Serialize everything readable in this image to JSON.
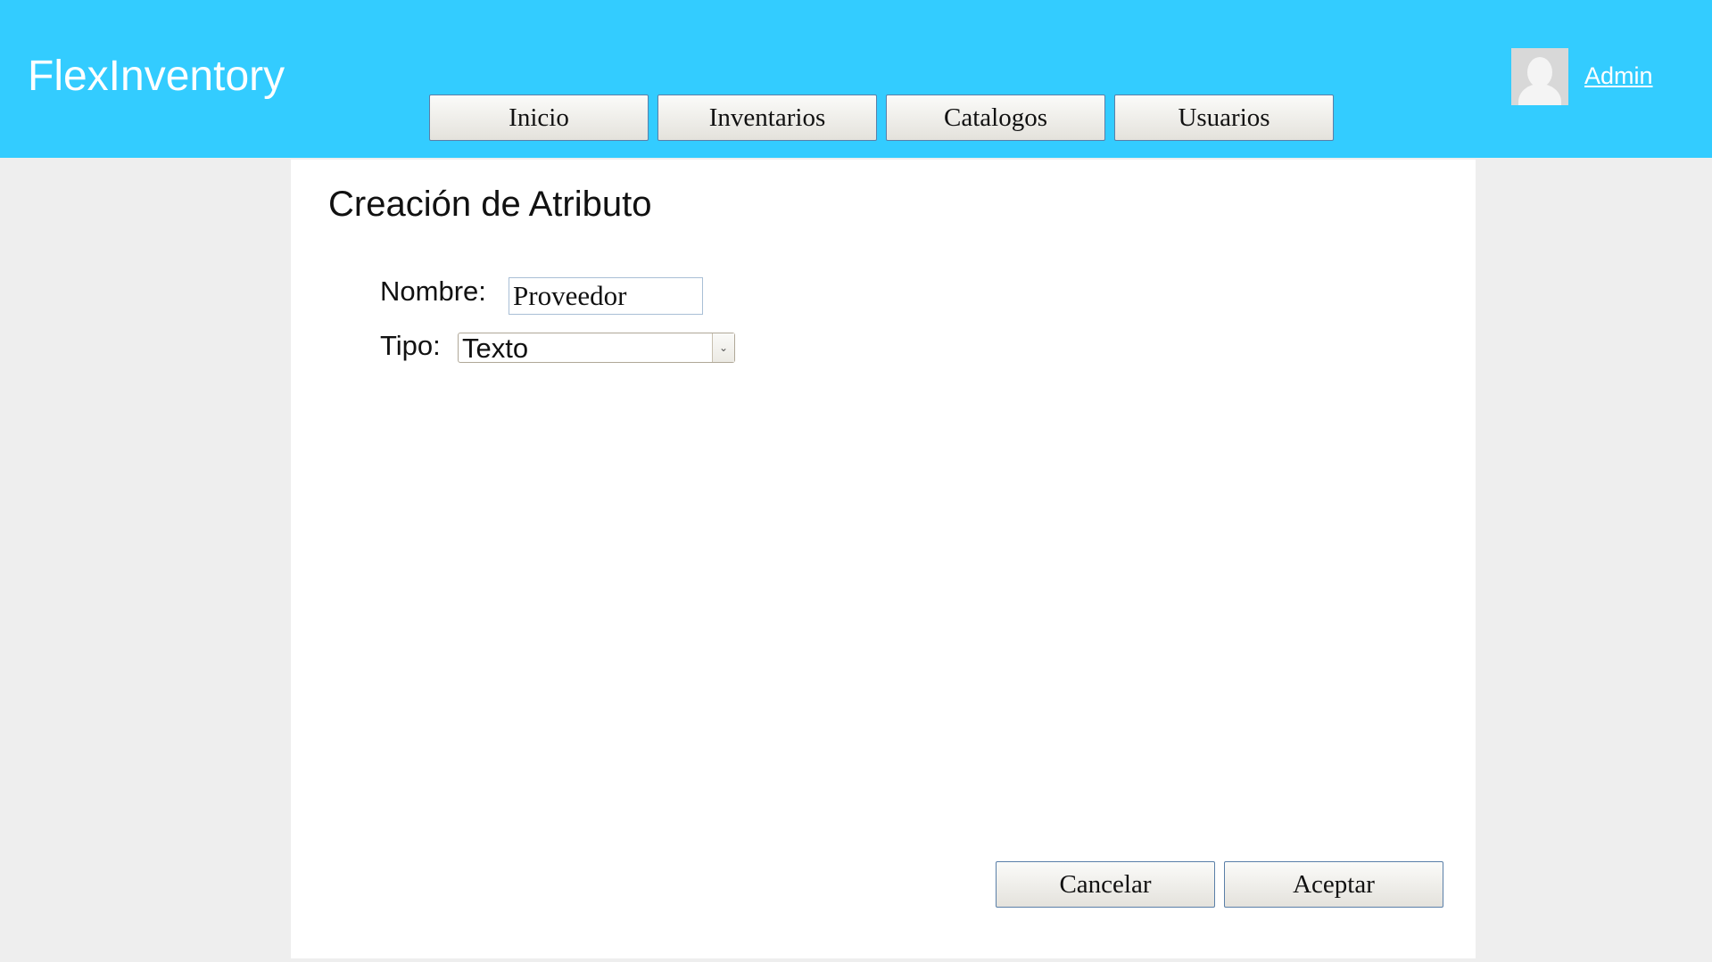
{
  "header": {
    "app_title": "FlexInventory",
    "nav": [
      {
        "label": "Inicio"
      },
      {
        "label": "Inventarios"
      },
      {
        "label": "Catalogos"
      },
      {
        "label": "Usuarios"
      }
    ],
    "user": {
      "name": "Admin",
      "avatar_icon": "user-avatar-icon"
    }
  },
  "main": {
    "title": "Creación de Atributo",
    "form": {
      "nombre_label": "Nombre:",
      "nombre_value": "Proveedor",
      "tipo_label": "Tipo:",
      "tipo_value": "Texto",
      "tipo_arrow": "⌄"
    },
    "actions": {
      "cancel": "Cancelar",
      "accept": "Aceptar"
    }
  },
  "colors": {
    "header": "#33ccff",
    "sidebar": "#eeeeee"
  }
}
